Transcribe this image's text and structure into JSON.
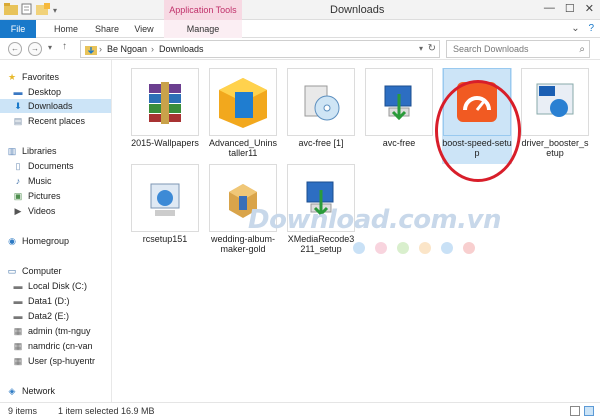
{
  "window": {
    "title": "Downloads",
    "context_tab_header": "Application Tools"
  },
  "ribbon": {
    "tabs": [
      "File",
      "Home",
      "Share",
      "View",
      "Manage"
    ]
  },
  "address": {
    "crumbs": [
      "Be Ngoan",
      "Downloads"
    ],
    "search_placeholder": "Search Downloads"
  },
  "nav": {
    "favorites": "Favorites",
    "desktop": "Desktop",
    "downloads": "Downloads",
    "recent": "Recent places",
    "libraries": "Libraries",
    "documents": "Documents",
    "music": "Music",
    "pictures": "Pictures",
    "videos": "Videos",
    "homegroup": "Homegroup",
    "computer": "Computer",
    "drive_c": "Local Disk (C:)",
    "drive_d": "Data1 (D:)",
    "drive_e": "Data2 (E:)",
    "net1": "admin (tm-nguy",
    "net2": "namdric (cn-van",
    "net3": "User (sp-huyentr",
    "network": "Network"
  },
  "files": [
    {
      "name": "2015-Wallpapers"
    },
    {
      "name": "Advanced_Uninstaller11"
    },
    {
      "name": "avc-free [1]"
    },
    {
      "name": "avc-free"
    },
    {
      "name": "boost-speed-setup"
    },
    {
      "name": "driver_booster_setup"
    },
    {
      "name": "rcsetup151"
    },
    {
      "name": "wedding-album-maker-gold"
    },
    {
      "name": "XMediaRecode3211_setup"
    }
  ],
  "status": {
    "count": "9 items",
    "selected": "1 item selected  16.9 MB"
  },
  "watermark": {
    "text": "Download.com.vn"
  },
  "colors": {
    "accent": "#1979ca",
    "selection": "#cce4f7",
    "highlight_ring": "#d81e2a",
    "context_tab": "#c0306a"
  }
}
